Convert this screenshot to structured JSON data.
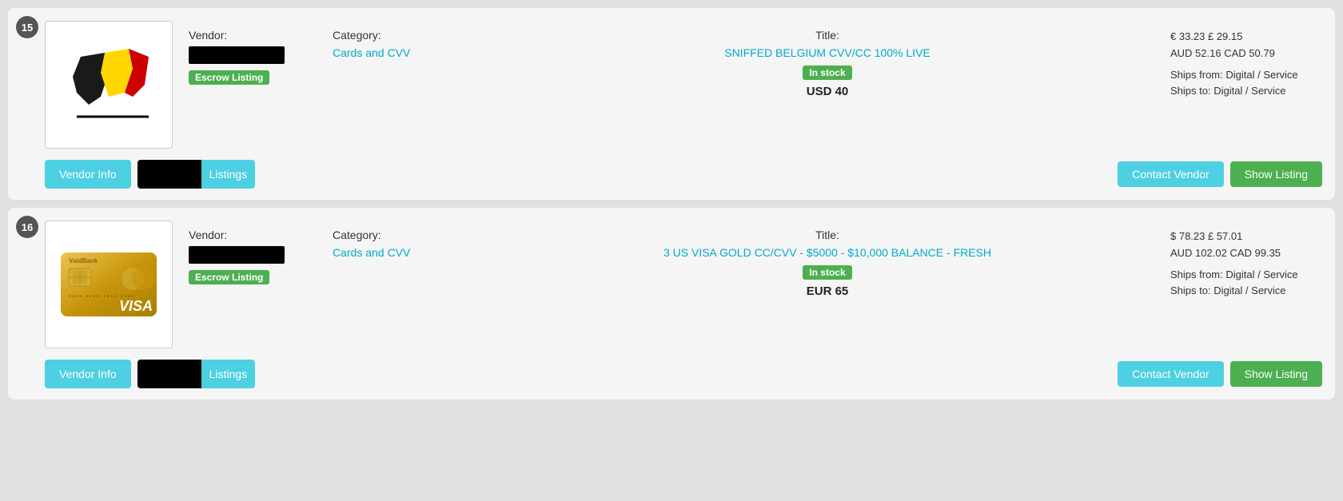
{
  "listings": [
    {
      "number": "15",
      "vendor_label": "Vendor:",
      "category_label": "Category:",
      "title_label": "Title:",
      "category": "Cards and CVV",
      "title": "SNIFFED BELGIUM CVV/CC 100% LIVE",
      "in_stock": "In stock",
      "price": "USD 40",
      "price_alt_line1": "€ 33.23  £ 29.15",
      "price_alt_line2": "AUD 52.16  CAD 50.79",
      "ships_from": "Ships from: Digital / Service",
      "ships_to": "Ships to: Digital / Service",
      "escrow_label": "Escrow Listing",
      "vendor_info_btn": "Vendor Info",
      "listings_btn": "Listings",
      "contact_vendor_btn": "Contact Vendor",
      "show_listing_btn": "Show Listing",
      "image_type": "belgium_flag"
    },
    {
      "number": "16",
      "vendor_label": "Vendor:",
      "category_label": "Category:",
      "title_label": "Title:",
      "category": "Cards and CVV",
      "title": "3 US VISA GOLD CC/CVV - $5000 - $10,000 BALANCE - FRESH",
      "in_stock": "In stock",
      "price": "EUR 65",
      "price_alt_line1": "$ 78.23  £ 57.01",
      "price_alt_line2": "AUD 102.02  CAD 99.35",
      "ships_from": "Ships from: Digital / Service",
      "ships_to": "Ships to: Digital / Service",
      "escrow_label": "Escrow Listing",
      "vendor_info_btn": "Vendor Info",
      "listings_btn": "Listings",
      "contact_vendor_btn": "Contact Vendor",
      "show_listing_btn": "Show Listing",
      "image_type": "visa_card"
    }
  ]
}
